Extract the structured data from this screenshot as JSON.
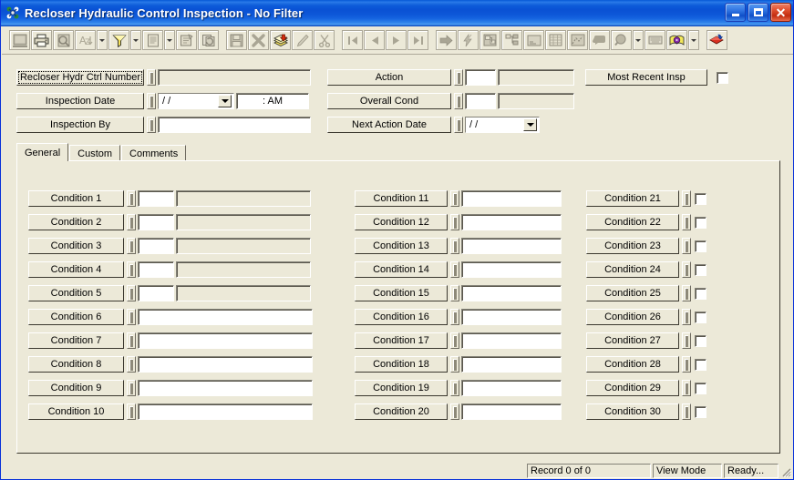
{
  "window": {
    "title": "Recloser Hydraulic Control Inspection - No Filter",
    "icon": "app-icon",
    "minimize_label": "_",
    "maximize_label": "",
    "close_label": "✕"
  },
  "toolbar": {
    "buttons": [
      {
        "name": "select-records-icon",
        "state": "disabled"
      },
      {
        "name": "print-icon",
        "state": "enabled"
      },
      {
        "name": "print-preview-icon",
        "state": "disabled"
      },
      {
        "name": "sort-icon",
        "state": "disabled",
        "dropdown": true
      },
      {
        "name": "filter-funnel-icon",
        "state": "enabled",
        "dropdown": true
      },
      {
        "name": "report-icon",
        "state": "disabled",
        "dropdown": true
      },
      {
        "name": "properties-icon",
        "state": "disabled"
      },
      {
        "name": "refresh-icon",
        "state": "disabled"
      },
      {
        "name": "save-icon",
        "state": "disabled"
      },
      {
        "name": "delete-icon",
        "state": "disabled"
      },
      {
        "name": "new-record-icon",
        "state": "enabled"
      },
      {
        "name": "edit-pencil-icon",
        "state": "disabled"
      },
      {
        "name": "cut-scissors-icon",
        "state": "disabled"
      },
      {
        "name": "first-record-icon",
        "state": "disabled"
      },
      {
        "name": "previous-record-icon",
        "state": "disabled"
      },
      {
        "name": "next-record-icon",
        "state": "disabled"
      },
      {
        "name": "last-record-icon",
        "state": "disabled"
      },
      {
        "name": "goto-icon",
        "state": "disabled"
      },
      {
        "name": "lightning-icon",
        "state": "disabled"
      },
      {
        "name": "related-records-icon",
        "state": "disabled"
      },
      {
        "name": "hierarchy-icon",
        "state": "disabled"
      },
      {
        "name": "notes-icon",
        "state": "disabled"
      },
      {
        "name": "grid-view-icon",
        "state": "disabled"
      },
      {
        "name": "map-icon",
        "state": "disabled"
      },
      {
        "name": "comment-icon",
        "state": "disabled"
      },
      {
        "name": "search-magnifier-icon",
        "state": "disabled",
        "dropdown": true
      },
      {
        "name": "keyboard-icon",
        "state": "disabled"
      },
      {
        "name": "help-book-icon",
        "state": "enabled",
        "dropdown": true
      },
      {
        "name": "exit-icon",
        "state": "enabled"
      }
    ]
  },
  "header": {
    "left_rows": [
      {
        "label": "Recloser Hydr Ctrl Number",
        "focused": true,
        "field_value": "",
        "field_kind": "gray"
      },
      {
        "label": "Inspection Date",
        "focused": false,
        "combo_value": "  /  /",
        "time_value": "   :    AM",
        "field_kind": "combo-time"
      },
      {
        "label": "Inspection By",
        "focused": false,
        "field_value": "",
        "field_kind": "white"
      }
    ],
    "mid_rows": [
      {
        "label": "Action",
        "code_value": "",
        "desc_value": "",
        "field_kind": "code-desc"
      },
      {
        "label": "Overall Cond",
        "code_value": "",
        "desc_value": "",
        "field_kind": "code-desc"
      },
      {
        "label": "Next Action Date",
        "combo_value": "  /  /",
        "field_kind": "combo"
      }
    ],
    "right_row": {
      "label": "Most Recent Insp",
      "checked": false
    }
  },
  "tabs": [
    {
      "label": "General",
      "active": true
    },
    {
      "label": "Custom",
      "active": false
    },
    {
      "label": "Comments",
      "active": false
    }
  ],
  "conditions": {
    "column_left": [
      {
        "label": "Condition 1",
        "kind": "code-desc",
        "code_value": "",
        "desc_value": ""
      },
      {
        "label": "Condition 2",
        "kind": "code-desc",
        "code_value": "",
        "desc_value": ""
      },
      {
        "label": "Condition 3",
        "kind": "code-desc",
        "code_value": "",
        "desc_value": ""
      },
      {
        "label": "Condition 4",
        "kind": "code-desc",
        "code_value": "",
        "desc_value": ""
      },
      {
        "label": "Condition 5",
        "kind": "code-desc",
        "code_value": "",
        "desc_value": ""
      },
      {
        "label": "Condition 6",
        "kind": "text",
        "value": ""
      },
      {
        "label": "Condition 7",
        "kind": "text",
        "value": ""
      },
      {
        "label": "Condition 8",
        "kind": "text",
        "value": ""
      },
      {
        "label": "Condition 9",
        "kind": "text",
        "value": ""
      },
      {
        "label": "Condition 10",
        "kind": "text",
        "value": ""
      }
    ],
    "column_mid": [
      {
        "label": "Condition 11",
        "kind": "text",
        "value": ""
      },
      {
        "label": "Condition 12",
        "kind": "text",
        "value": ""
      },
      {
        "label": "Condition 13",
        "kind": "text",
        "value": ""
      },
      {
        "label": "Condition 14",
        "kind": "text",
        "value": ""
      },
      {
        "label": "Condition 15",
        "kind": "text",
        "value": ""
      },
      {
        "label": "Condition 16",
        "kind": "text",
        "value": ""
      },
      {
        "label": "Condition 17",
        "kind": "text",
        "value": ""
      },
      {
        "label": "Condition 18",
        "kind": "text",
        "value": ""
      },
      {
        "label": "Condition 19",
        "kind": "text",
        "value": ""
      },
      {
        "label": "Condition 20",
        "kind": "text",
        "value": ""
      }
    ],
    "column_right": [
      {
        "label": "Condition 21",
        "kind": "check",
        "checked": false
      },
      {
        "label": "Condition 22",
        "kind": "check",
        "checked": false
      },
      {
        "label": "Condition 23",
        "kind": "check",
        "checked": false
      },
      {
        "label": "Condition 24",
        "kind": "check",
        "checked": false
      },
      {
        "label": "Condition 25",
        "kind": "check",
        "checked": false
      },
      {
        "label": "Condition 26",
        "kind": "check",
        "checked": false
      },
      {
        "label": "Condition 27",
        "kind": "check",
        "checked": false
      },
      {
        "label": "Condition 28",
        "kind": "check",
        "checked": false
      },
      {
        "label": "Condition 29",
        "kind": "check",
        "checked": false
      },
      {
        "label": "Condition 30",
        "kind": "check",
        "checked": false
      }
    ]
  },
  "statusbar": {
    "record": "Record 0 of 0",
    "mode": "View Mode",
    "state": "Ready...",
    "grip": "resize-grip"
  },
  "colors": {
    "titlebar_blue": "#0a58d6",
    "face": "#ece9d8",
    "field_white": "#ffffff",
    "shadow": "#848278",
    "close_red": "#c32c10"
  }
}
